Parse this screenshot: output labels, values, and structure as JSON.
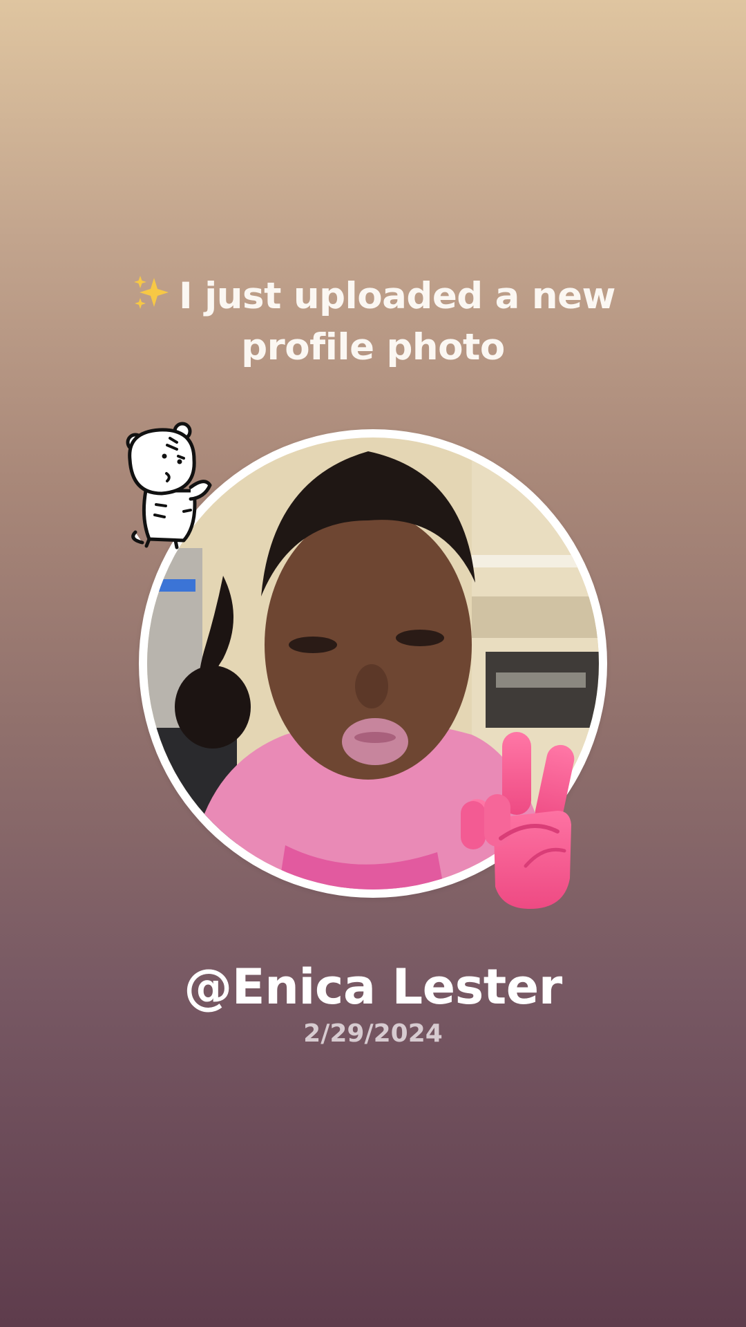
{
  "post": {
    "headline_line1": "I just uploaded a new",
    "headline_line2": "profile photo",
    "sparkle_icon": "sparkles-icon",
    "username": "@Enica Lester",
    "date": "2/29/2024"
  },
  "stickers": {
    "top_left": "tiger-sticker",
    "bottom_right": "victory-hand-sticker"
  },
  "colors": {
    "background_top": "#dfc5a0",
    "background_bottom": "#5e3c4c",
    "text": "#ffffff",
    "date_text": "#d7cbd0",
    "peace_sticker": "#f25a92"
  }
}
